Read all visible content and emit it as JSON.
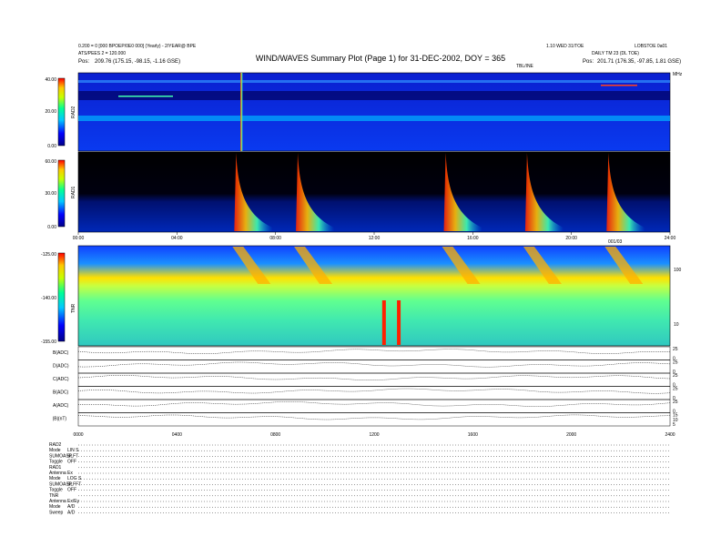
{
  "header": {
    "title": "WIND/WAVES Summary Plot (Page 1) for 31-DEC-2002, DOY = 365",
    "left_line1": "0.200 = 0 [000 BPOEP/0E0 000] (Yearly) - 2/YEAR@ BPE",
    "left_line2": "ATS/PEES 2 = 120.000",
    "left_pos_label": "Pos:",
    "left_pos_value": "209.76 (175.15, -98.15, -1.16 GSE)",
    "right_line1": "1.10 WED 31/TOE",
    "right_line1b": "LOBSTOE 0a01",
    "right_line2": "DAILY TM 23 (DL TOE)",
    "right_pos_label": "Pos:",
    "right_pos_value": "201.71 (176.35, -97.85, 1.81 GSE)",
    "mini_label": "TBL/INE",
    "mhz_label": "MHz"
  },
  "panels": {
    "rad2": {
      "name": "RAD2",
      "ticks": [
        "40.00",
        "20.00",
        "0.00"
      ]
    },
    "rad1": {
      "name": "RAD1",
      "ticks": [
        "60.00",
        "30.00",
        "0.00"
      ]
    },
    "tnr": {
      "name": "TNR",
      "ticks": [
        "-125.00",
        "-140.00",
        "-155.00"
      ],
      "right_ticks": [
        "100",
        "10"
      ]
    },
    "xaxis_top": [
      "00:00",
      "04:00",
      "08:00",
      "12:00",
      "16:00",
      "20:00",
      "24:00"
    ],
    "day_label": "001/03",
    "xaxis_bottom": [
      "0000",
      "0400",
      "0800",
      "1200",
      "1600",
      "2000",
      "2400"
    ]
  },
  "lines": [
    {
      "label": "B(ADC)",
      "right": [
        "25",
        "0"
      ]
    },
    {
      "label": "D(ADC)",
      "right": [
        "25",
        "0"
      ]
    },
    {
      "label": "C(ADC)",
      "right": [
        "25",
        "0"
      ]
    },
    {
      "label": "B(ADC)",
      "right": [
        "25",
        "0"
      ]
    },
    {
      "label": "A(ADC)",
      "right": [
        "25",
        "0"
      ]
    },
    {
      "label": "|B|(nT)",
      "right": [
        "15",
        "10",
        "5"
      ]
    }
  ],
  "settings": [
    {
      "label": "RAD2",
      "value": ""
    },
    {
      "label": "Mode",
      "value": "LIN S"
    },
    {
      "label": "SUMOASP",
      "value": "SLFT"
    },
    {
      "label": "Toggle",
      "value": "OFF"
    },
    {
      "label": "RAD1",
      "value": ""
    },
    {
      "label": "Antenna",
      "value": "Ex"
    },
    {
      "label": "Mode",
      "value": "LOG S"
    },
    {
      "label": "SUMOASP",
      "value": "SLFFT"
    },
    {
      "label": "Toggle",
      "value": "OFF"
    },
    {
      "label": "TNR",
      "value": ""
    },
    {
      "label": "Antenna",
      "value": "Ex/Ey"
    },
    {
      "label": "Mode",
      "value": "A/D"
    },
    {
      "label": "Sweep",
      "value": "A/D"
    }
  ],
  "chart_data": {
    "type": "heatmap",
    "title": "WIND/WAVES Summary Plot (Page 1) for 31-DEC-2002, DOY = 365",
    "xlim": [
      "00:00",
      "24:00"
    ],
    "panels": [
      {
        "name": "RAD2",
        "ylim": [
          0,
          40
        ]
      },
      {
        "name": "RAD1",
        "ylim": [
          0,
          60
        ]
      },
      {
        "name": "TNR",
        "ylim": [
          -155,
          -125
        ]
      }
    ],
    "colormap": [
      "#000088",
      "#0000ff",
      "#00c8ff",
      "#00ff96",
      "#c8ff00",
      "#ffc800",
      "#ff0000"
    ],
    "type_iii_bursts_hours": [
      6.4,
      8.9,
      14.9,
      18.2,
      21.5
    ],
    "tnr_vertical_events_hours": [
      12.4,
      13.0
    ],
    "line_plots": [
      "B(ADC)",
      "D(ADC)",
      "C(ADC)",
      "B(ADC)",
      "A(ADC)",
      "|B|(nT)"
    ]
  }
}
